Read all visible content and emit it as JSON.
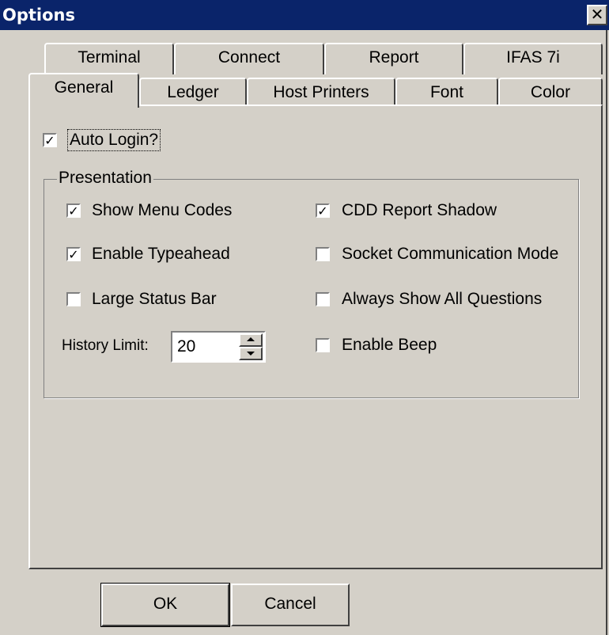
{
  "window": {
    "title": "Options",
    "close_glyph": "✕"
  },
  "tabs": {
    "row_back": [
      "Terminal",
      "Connect",
      "Report",
      "IFAS 7i"
    ],
    "row_front": [
      "General",
      "Ledger",
      "Host Printers",
      "Font",
      "Color"
    ],
    "selected": "General"
  },
  "general": {
    "auto_login": {
      "label": "Auto Login?",
      "checked": true
    },
    "presentation": {
      "legend": "Presentation",
      "left": [
        {
          "label": "Show Menu Codes",
          "checked": true
        },
        {
          "label": "Enable Typeahead",
          "checked": true
        },
        {
          "label": "Large Status Bar",
          "checked": false
        }
      ],
      "right": [
        {
          "label": "CDD Report Shadow",
          "checked": true
        },
        {
          "label": "Socket Communication Mode",
          "checked": false
        },
        {
          "label": "Always Show All Questions",
          "checked": false
        },
        {
          "label": "Enable Beep",
          "checked": false
        }
      ],
      "history_limit": {
        "label": "History Limit:",
        "value": "20"
      }
    }
  },
  "buttons": {
    "ok": "OK",
    "cancel": "Cancel"
  },
  "icons": {
    "close": "close-icon",
    "checkmark": "checkmark-icon",
    "cursor": "arrow-cursor-icon"
  },
  "colors": {
    "titlebar": "#0a246a",
    "face": "#d4d0c8"
  }
}
